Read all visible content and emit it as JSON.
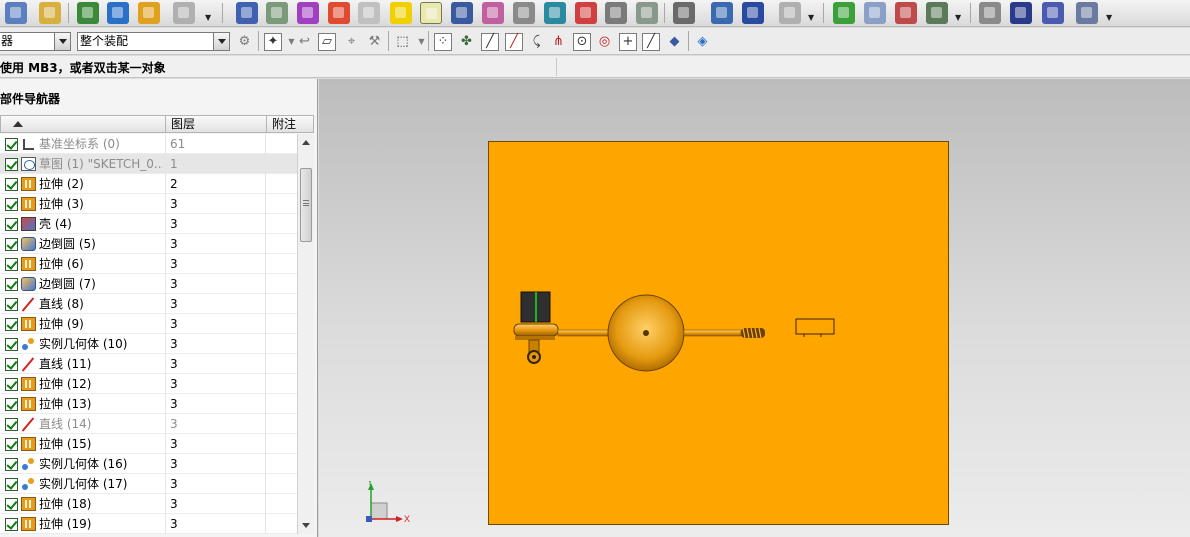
{
  "toolbar2": {
    "filter_value": "器",
    "scope_value": "整个装配"
  },
  "status": {
    "text": "使用 MB3，或者双击某一对象"
  },
  "navigator": {
    "title": "部件导航器",
    "columns": [
      "",
      "图层",
      "附注"
    ],
    "rows": [
      {
        "icon": "datum-csys-icon",
        "name": "基准坐标系 (0)",
        "layer": "61",
        "dim": true
      },
      {
        "icon": "sketch-icon",
        "name": "草图 (1) \"SKETCH_0...",
        "layer": "1",
        "dim": true
      },
      {
        "icon": "extrude-icon",
        "name": "拉伸 (2)",
        "layer": "2",
        "dim": false
      },
      {
        "icon": "extrude-icon",
        "name": "拉伸 (3)",
        "layer": "3",
        "dim": false
      },
      {
        "icon": "shell-icon",
        "name": "壳 (4)",
        "layer": "3",
        "dim": false
      },
      {
        "icon": "edge-blend-icon",
        "name": "边倒圆 (5)",
        "layer": "3",
        "dim": false
      },
      {
        "icon": "extrude-icon",
        "name": "拉伸 (6)",
        "layer": "3",
        "dim": false
      },
      {
        "icon": "edge-blend-icon",
        "name": "边倒圆 (7)",
        "layer": "3",
        "dim": false
      },
      {
        "icon": "line-icon",
        "name": "直线 (8)",
        "layer": "3",
        "dim": false
      },
      {
        "icon": "extrude-icon",
        "name": "拉伸 (9)",
        "layer": "3",
        "dim": false
      },
      {
        "icon": "instance-geometry-icon",
        "name": "实例几何体 (10)",
        "layer": "3",
        "dim": false
      },
      {
        "icon": "line-icon",
        "name": "直线 (11)",
        "layer": "3",
        "dim": false
      },
      {
        "icon": "extrude-icon",
        "name": "拉伸 (12)",
        "layer": "3",
        "dim": false
      },
      {
        "icon": "extrude-icon",
        "name": "拉伸 (13)",
        "layer": "3",
        "dim": false
      },
      {
        "icon": "line-icon",
        "name": "直线 (14)",
        "layer": "3",
        "dim": true
      },
      {
        "icon": "extrude-icon",
        "name": "拉伸 (15)",
        "layer": "3",
        "dim": false
      },
      {
        "icon": "instance-geometry-icon",
        "name": "实例几何体 (16)",
        "layer": "3",
        "dim": false
      },
      {
        "icon": "instance-geometry-icon",
        "name": "实例几何体 (17)",
        "layer": "3",
        "dim": false
      },
      {
        "icon": "extrude-icon",
        "name": "拉伸 (18)",
        "layer": "3",
        "dim": false
      },
      {
        "icon": "extrude-icon",
        "name": "拉伸 (19)",
        "layer": "3",
        "dim": false
      }
    ]
  },
  "graphics": {
    "part_color": "#ffa500",
    "triad": {
      "x_label": "X",
      "y_label": "Y"
    }
  }
}
